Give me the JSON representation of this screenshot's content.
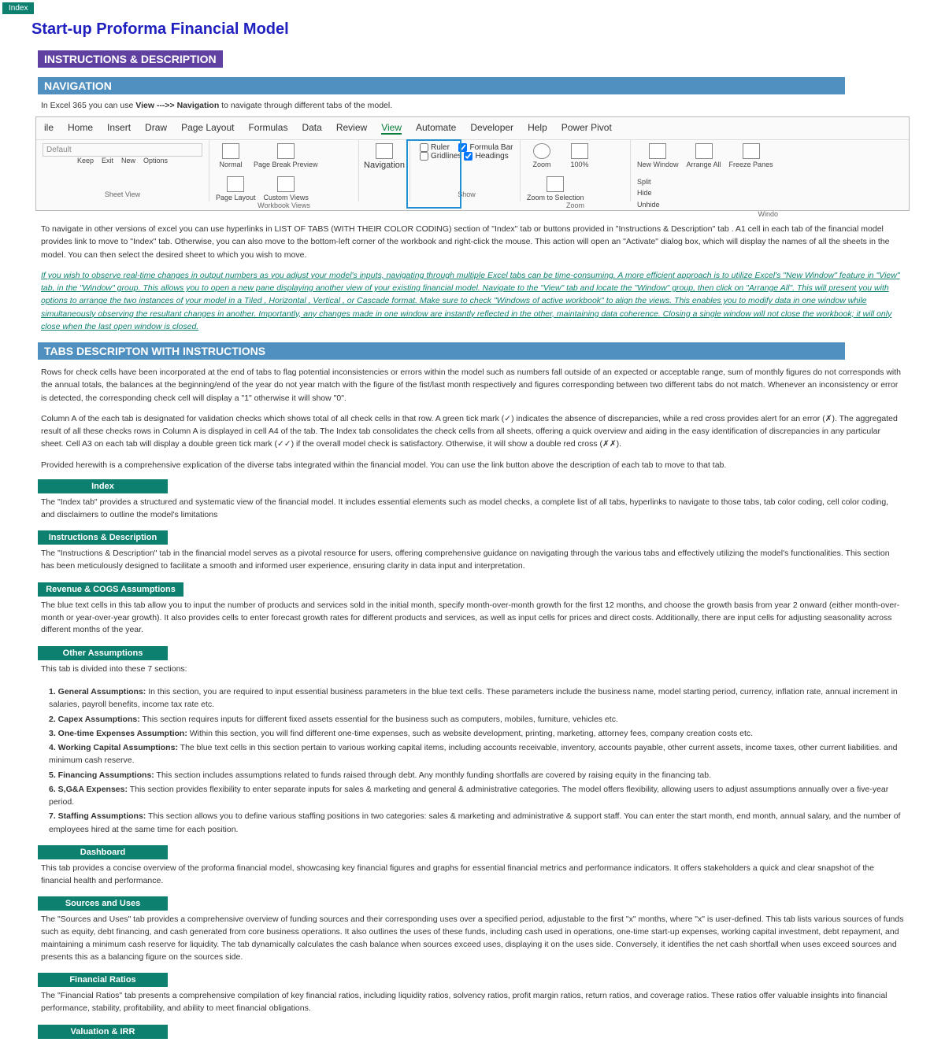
{
  "indexTab": "Index",
  "title": "Start-up Proforma Financial Model",
  "instructionsHdr": "INSTRUCTIONS & DESCRIPTION",
  "navHdr": "NAVIGATION",
  "navIntro": {
    "pre": "In Excel 365 you can use ",
    "b1": "View  --->> Navigation",
    "post": " to navigate through different tabs of the model."
  },
  "ribbon": {
    "tabs": [
      "ile",
      "Home",
      "Insert",
      "Draw",
      "Page Layout",
      "Formulas",
      "Data",
      "Review",
      "View",
      "Automate",
      "Developer",
      "Help",
      "Power Pivot"
    ],
    "active": "View",
    "sheetView": {
      "default": "Default",
      "keep": "Keep",
      "exit": "Exit",
      "new": "New",
      "options": "Options",
      "label": "Sheet View"
    },
    "workbook": {
      "normal": "Normal",
      "pagebreak": "Page Break Preview",
      "pagelayout": "Page Layout",
      "custom": "Custom Views",
      "label": "Workbook Views"
    },
    "navigation": "Navigation",
    "show": {
      "ruler": "Ruler",
      "formula": "Formula Bar",
      "gridlines": "Gridlines",
      "headings": "Headings",
      "label": "Show"
    },
    "zoom": {
      "zoom": "Zoom",
      "hundred": "100%",
      "selection": "Zoom to Selection",
      "label": "Zoom"
    },
    "window": {
      "newwin": "New Window",
      "arrange": "Arrange All",
      "freeze": "Freeze Panes",
      "split": "Split",
      "hide": "Hide",
      "unhide": "Unhide",
      "label": "Windo"
    }
  },
  "para1": "To navigate in other versions of excel you can use hyperlinks in LIST OF TABS (WITH THEIR COLOR CODING) section of \"Index\" tab or buttons provided in  \"Instructions & Description\" tab . A1 cell in each tab of the financial model provides link to move to \"Index\" tab. Otherwise, you can also move to the bottom-left corner of the workbook and right-click the mouse. This action will open an \"Activate\" dialog box, which will display the names of all the sheets in the model. You can then select the desired sheet to which you wish to move.",
  "italicPara": "If you wish to observe real-time changes in output numbers as you adjust your model's inputs, navigating through multiple Excel tabs can be time-consuming. A more efficient approach is to utilize Excel's \"New Window\" feature in \"View\" tab, in the \"Window\" group. This allows you to open a new pane displaying another view of your existing financial model. Navigate to the \"View\" tab and locate the \"Window\" group, then click on \"Arrange All\".  This will present you with options to arrange the two instances of your model in a Tiled , Horizontal , Vertical , or Cascade  format. Make sure to check \"Windows of active workbook\" to align the views. This  enables you to modify data in one window while simultaneously observing the resultant changes in another. Importantly, any changes made in one window are instantly reflected in the other, maintaining data coherence. Closing a single window will not close the workbook; it will only close when the last open window is closed.",
  "tabsDescHdr": "TABS DESCRIPTON WITH INSTRUCTIONS",
  "tabsPara1": "Rows for check cells have been incorporated at the end of tabs to flag potential inconsistencies or errors within the model such as numbers fall outside of an expected or acceptable range, sum of monthly figures do not corresponds with the annual totals, the balances at the beginning/end of the year do not year match with the figure of the fist/last month respectively and figures corresponding between two different tabs do not match. Whenever an inconsistency or error is detected, the corresponding check cell will display a \"1\" otherwise it will show \"0\".",
  "tabsPara2": "Column A of the each tab is designated for validation checks which shows total of all check cells in that row. A green tick mark (✓) indicates the absence of discrepancies, while a red cross provides alert for an error (✗). The aggregated result of all these checks rows in Column A is displayed in cell A4 of the tab. The Index tab consolidates the check cells from all sheets, offering a quick overview and aiding in the easy identification of discrepancies in any particular sheet. Cell A3 on each tab will display a double green tick mark (✓✓) if the overall model check is satisfactory. Otherwise, it will show a double red cross (✗✗).",
  "tabsPara3": "Provided herewith is a comprehensive explication of the diverse tabs integrated within the financial model. You can use the link button above the description of each tab to move to that tab.",
  "tabs": {
    "index": {
      "label": "Index",
      "desc": "The \"Index tab\" provides a structured and systematic view of the financial model. It includes essential elements such as model checks, a complete list of all tabs, hyperlinks to navigate to those tabs, tab color coding, cell color coding, and disclaimers to outline the model's limitations"
    },
    "instr": {
      "label": "Instructions & Description",
      "desc": "The \"Instructions & Description\" tab in the financial model serves as a pivotal resource for users, offering comprehensive guidance on navigating through the various tabs and effectively utilizing the model's functionalities. This section has been meticulously designed to facilitate a smooth and informed user experience, ensuring clarity in data input and interpretation."
    },
    "revenue": {
      "label": "Revenue & COGS Assumptions",
      "desc": "The blue text cells in this tab allow you to input the number of products and services sold in the initial month, specify month-over-month growth for the first 12 months, and choose the growth basis from year 2 onward (either month-over-month or year-over-year growth). It also provides cells to enter forecast growth rates for different products and services, as well as input cells for prices and direct costs. Additionally, there are input cells for adjusting seasonality across different months of the year."
    },
    "other": {
      "label": "Other Assumptions",
      "intro": "This tab is divided into these 7 sections:",
      "items": [
        {
          "b": "1. General Assumptions:",
          "t": " In this section, you are required to input essential business parameters in the blue text cells. These parameters include the business name, model starting period, currency, inflation rate, annual increment in salaries, payroll benefits, income tax rate etc."
        },
        {
          "b": "2. Capex Assumptions:",
          "t": " This section requires inputs for different fixed assets essential for the business such as computers, mobiles, furniture, vehicles etc."
        },
        {
          "b": "3. One-time Expenses Assumption:",
          "t": " Within this section, you will find different one-time expenses, such as website development, printing, marketing, attorney fees, company creation costs etc."
        },
        {
          "b": "4. Working Capital Assumptions:",
          "t": " The blue text cells in this section pertain to various working capital items, including accounts receivable, inventory, accounts payable, other current assets, income taxes, other current liabilities. and minimum cash reserve."
        },
        {
          "b": "5. Financing Assumptions:",
          "t": " This section includes assumptions related to funds raised through debt. Any monthly funding shortfalls are covered by raising equity in the financing tab."
        },
        {
          "b": "6. S,G&A Expenses:",
          "t": " This section provides flexibility to enter separate inputs for sales & marketing and general & administrative categories.  The model offers flexibility, allowing users to adjust assumptions annually  over a  five-year period."
        },
        {
          "b": "7. Staffing Assumptions:",
          "t": " This section allows you to define various staffing positions in two categories: sales & marketing and administrative & support staff. You can enter the start month, end month, annual salary, and the number of employees hired at the same time for each position."
        }
      ]
    },
    "dashboard": {
      "label": "Dashboard",
      "desc": "This tab provides a concise overview of the proforma financial model, showcasing key financial figures and graphs for essential financial metrics and performance indicators. It offers stakeholders a quick and clear snapshot of the financial health and performance."
    },
    "sources": {
      "label": "Sources and Uses",
      "desc": "The \"Sources and Uses\" tab provides a comprehensive overview of funding sources and their corresponding uses over a specified period, adjustable to the first \"x\" months, where \"x\" is user-defined. This tab lists various sources of funds such as equity, debt financing, and cash generated from core business operations. It also outlines the uses of these funds, including cash used in operations, one-time start-up expenses, working capital investment, debt repayment, and maintaining  a minimum cash reserve for liquidity. The tab dynamically calculates the cash balance when sources exceed uses, displaying it on the uses side. Conversely, it identifies the net cash shortfall when uses exceed sources and presents this as a balancing figure on the sources side."
    },
    "ratios": {
      "label": "Financial Ratios",
      "desc": "The \"Financial Ratios\" tab presents a comprehensive compilation of key financial ratios, including liquidity ratios, solvency ratios, profit margin ratios, return ratios, and coverage ratios. These ratios offer valuable insights into financial performance, stability, profitability, and ability to meet financial obligations."
    },
    "valuation": {
      "label": "Valuation & IRR"
    }
  }
}
